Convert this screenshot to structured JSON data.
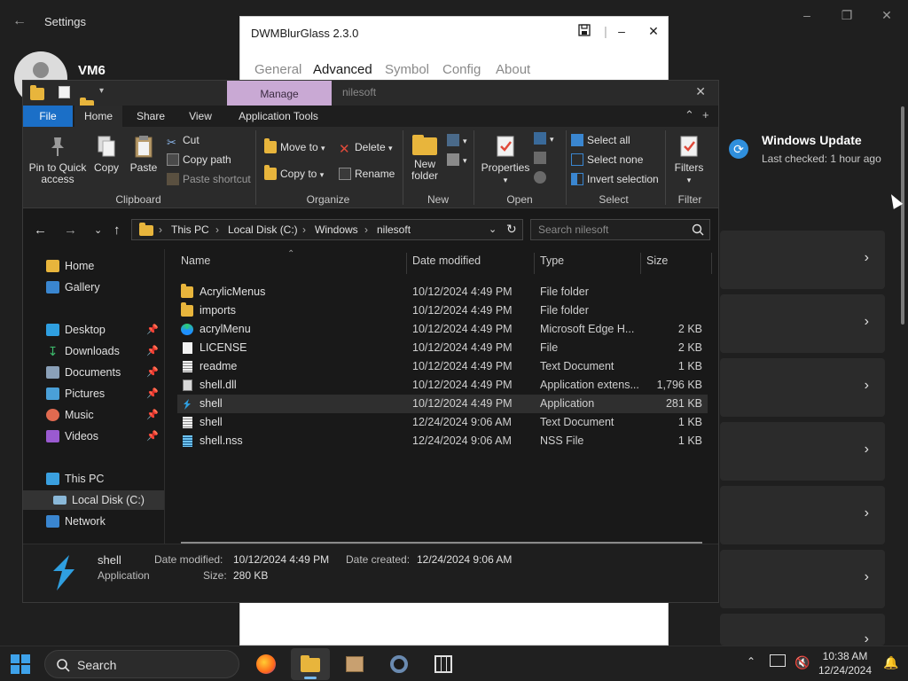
{
  "settings": {
    "title": "Settings",
    "user_name": "VM6",
    "windows_update": {
      "title": "Windows Update",
      "subtitle": "Last checked: 1 hour ago"
    }
  },
  "dwm": {
    "title": "DWMBlurGlass 2.3.0",
    "tabs": [
      {
        "label": "General",
        "active": false
      },
      {
        "label": "Advanced",
        "active": true
      },
      {
        "label": "Symbol",
        "active": false
      },
      {
        "label": "Config",
        "active": false
      },
      {
        "label": "About",
        "active": false
      }
    ]
  },
  "explorer": {
    "titlebar": {
      "manage_label": "Manage",
      "title": "nilesoft"
    },
    "ribbon_tabs": [
      "File",
      "Home",
      "Share",
      "View",
      "Application Tools"
    ],
    "ribbon": {
      "clipboard": {
        "pin_label": "Pin to Quick access",
        "copy_label": "Copy",
        "paste_label": "Paste",
        "cut_label": "Cut",
        "copy_path_label": "Copy path",
        "paste_shortcut_label": "Paste shortcut",
        "group_label": "Clipboard"
      },
      "organize": {
        "move_to_label": "Move to",
        "copy_to_label": "Copy to",
        "delete_label": "Delete",
        "rename_label": "Rename",
        "group_label": "Organize"
      },
      "new": {
        "new_folder_label": "New folder",
        "group_label": "New"
      },
      "open": {
        "properties_label": "Properties",
        "group_label": "Open"
      },
      "select": {
        "select_all_label": "Select all",
        "select_none_label": "Select none",
        "invert_label": "Invert selection",
        "group_label": "Select"
      },
      "filter": {
        "filters_label": "Filters",
        "group_label": "Filter"
      }
    },
    "address": {
      "crumbs": [
        "This PC",
        "Local Disk (C:)",
        "Windows",
        "nilesoft"
      ],
      "search_placeholder": "Search nilesoft"
    },
    "nav": {
      "items": [
        {
          "label": "Home",
          "icon": "home-icon",
          "pinned": false
        },
        {
          "label": "Gallery",
          "icon": "gallery-icon",
          "pinned": false
        },
        {
          "label": "Desktop",
          "icon": "desktop-icon",
          "pinned": true
        },
        {
          "label": "Downloads",
          "icon": "download-icon",
          "pinned": true
        },
        {
          "label": "Documents",
          "icon": "documents-icon",
          "pinned": true
        },
        {
          "label": "Pictures",
          "icon": "pictures-icon",
          "pinned": true
        },
        {
          "label": "Music",
          "icon": "music-icon",
          "pinned": true
        },
        {
          "label": "Videos",
          "icon": "videos-icon",
          "pinned": true
        },
        {
          "label": "This PC",
          "icon": "pc-icon",
          "pinned": false
        },
        {
          "label": "Local Disk (C:)",
          "icon": "drive-icon",
          "pinned": false,
          "selected": true
        },
        {
          "label": "Network",
          "icon": "network-icon",
          "pinned": false
        }
      ]
    },
    "columns": [
      "Name",
      "Date modified",
      "Type",
      "Size"
    ],
    "files": [
      {
        "name": "AcrylicMenus",
        "date": "10/12/2024 4:49 PM",
        "type": "File folder",
        "size": "",
        "icon": "folder-icon"
      },
      {
        "name": "imports",
        "date": "10/12/2024 4:49 PM",
        "type": "File folder",
        "size": "",
        "icon": "folder-icon"
      },
      {
        "name": "acrylMenu",
        "date": "10/12/2024 4:49 PM",
        "type": "Microsoft Edge H...",
        "size": "2 KB",
        "icon": "edge-icon"
      },
      {
        "name": "LICENSE",
        "date": "10/12/2024 4:49 PM",
        "type": "File",
        "size": "2 KB",
        "icon": "file-icon"
      },
      {
        "name": "readme",
        "date": "10/12/2024 4:49 PM",
        "type": "Text Document",
        "size": "1 KB",
        "icon": "text-file-icon"
      },
      {
        "name": "shell.dll",
        "date": "10/12/2024 4:49 PM",
        "type": "Application extens...",
        "size": "1,796 KB",
        "icon": "dll-icon"
      },
      {
        "name": "shell",
        "date": "10/12/2024 4:49 PM",
        "type": "Application",
        "size": "281 KB",
        "icon": "shell-app-icon",
        "selected": true
      },
      {
        "name": "shell",
        "date": "12/24/2024 9:06 AM",
        "type": "Text Document",
        "size": "1 KB",
        "icon": "text-file-icon"
      },
      {
        "name": "shell.nss",
        "date": "12/24/2024 9:06 AM",
        "type": "NSS File",
        "size": "1 KB",
        "icon": "nss-file-icon"
      }
    ],
    "details": {
      "name": "shell",
      "kind": "Application",
      "date_modified_label": "Date modified:",
      "date_modified": "10/12/2024 4:49 PM",
      "size_label": "Size:",
      "size": "280 KB",
      "date_created_label": "Date created:",
      "date_created": "12/24/2024 9:06 AM"
    }
  },
  "taskbar": {
    "search_label": "Search",
    "time": "10:38 AM",
    "date": "12/24/2024"
  },
  "colors": {
    "accent": "#1b6fc7",
    "manage_tab": "#c9a9d4",
    "folder": "#e8b53c"
  }
}
